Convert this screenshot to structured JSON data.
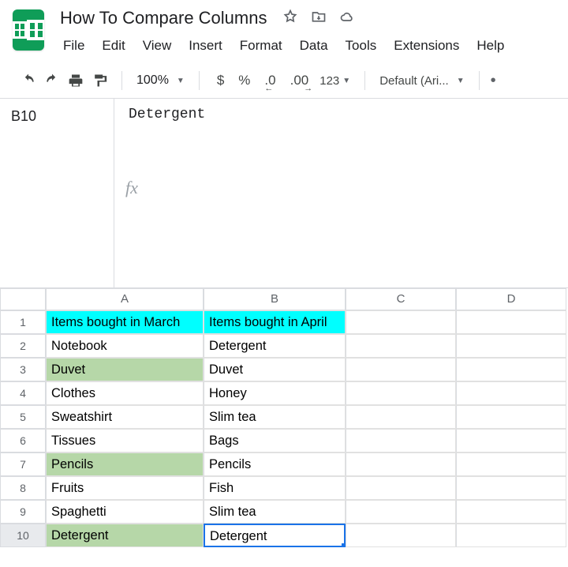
{
  "doc": {
    "title": "How To Compare Columns"
  },
  "menu": [
    "File",
    "Edit",
    "View",
    "Insert",
    "Format",
    "Data",
    "Tools",
    "Extensions",
    "Help"
  ],
  "toolbar": {
    "zoom": "100%",
    "currency": "$",
    "percent": "%",
    "decDecrease": ".0",
    "decIncrease": ".00",
    "numFmt": "123",
    "font": "Default (Ari..."
  },
  "nameBox": {
    "ref": "B10",
    "value": "Detergent"
  },
  "fx": "fx",
  "columns": [
    "A",
    "B",
    "C",
    "D"
  ],
  "rows": [
    {
      "n": "1",
      "a": "Items bought in March",
      "b": "Items bought in April",
      "hdr": true
    },
    {
      "n": "2",
      "a": "Notebook",
      "b": "Detergent"
    },
    {
      "n": "3",
      "a": "Duvet",
      "b": "Duvet",
      "hl": true
    },
    {
      "n": "4",
      "a": "Clothes",
      "b": "Honey"
    },
    {
      "n": "5",
      "a": "Sweatshirt",
      "b": "Slim tea"
    },
    {
      "n": "6",
      "a": "Tissues",
      "b": "Bags"
    },
    {
      "n": "7",
      "a": "Pencils",
      "b": "Pencils",
      "hl": true
    },
    {
      "n": "8",
      "a": "Fruits",
      "b": "Fish"
    },
    {
      "n": "9",
      "a": "Spaghetti",
      "b": "Slim tea"
    },
    {
      "n": "10",
      "a": "Detergent",
      "b": "Detergent",
      "hl": true,
      "sel": true
    }
  ]
}
